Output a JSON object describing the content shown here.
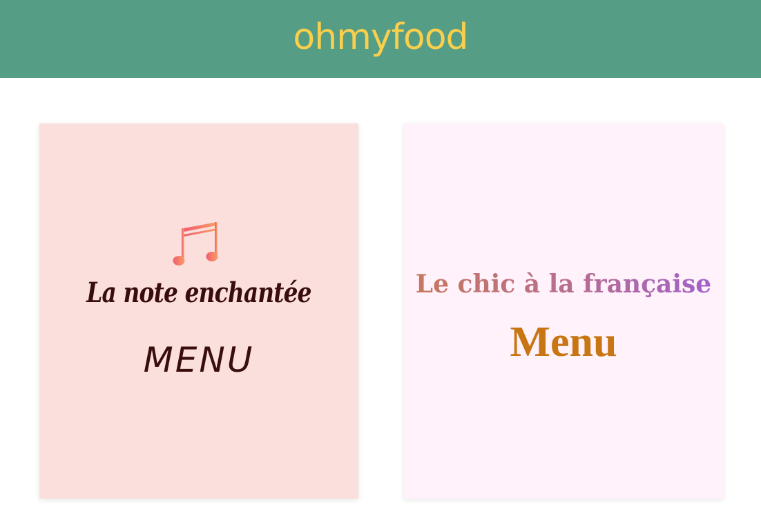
{
  "header": {
    "logo_text": "ohmyfood",
    "background_color": "#569d85",
    "logo_color": "#f9cf4c"
  },
  "restaurants": [
    {
      "name": "La note enchantée",
      "menu_label": "MENU",
      "icon": "music-note-icon",
      "background_color": "#fbdfdc",
      "text_color": "#3a0d0d",
      "icon_gradient": [
        "#f25c6a",
        "#f79f6a"
      ]
    },
    {
      "name": "Le chic à la française",
      "menu_label": "Menu",
      "background_color": "#fff2fb",
      "title_gradient": [
        "#c9775a",
        "#a060d0"
      ],
      "menu_color": "#c87514"
    }
  ]
}
